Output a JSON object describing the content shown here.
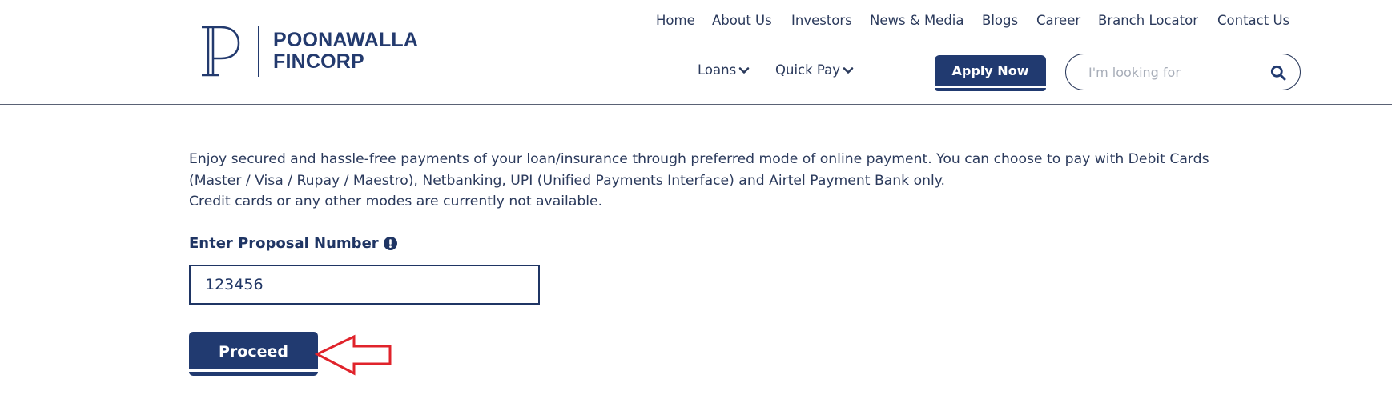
{
  "brand": {
    "name_line1": "POONAWALLA",
    "name_line2": "FINCORP",
    "logo_icon": "p-monogram-logo"
  },
  "top_nav": [
    {
      "label": "Home"
    },
    {
      "label": "About Us"
    },
    {
      "label": "Investors"
    },
    {
      "label": "News & Media"
    },
    {
      "label": "Blogs"
    },
    {
      "label": "Career"
    },
    {
      "label": "Branch Locator"
    },
    {
      "label": "Contact Us"
    }
  ],
  "dropdowns": {
    "loans": "Loans",
    "quick_pay": "Quick Pay"
  },
  "apply_button": "Apply Now",
  "search": {
    "placeholder": "I'm looking for",
    "icon": "search-icon"
  },
  "main": {
    "description_line1": "Enjoy secured and hassle-free payments of your loan/insurance through preferred mode of online payment. You can choose to pay with Debit Cards (Master / Visa / Rupay / Maestro), Netbanking, UPI (Unified Payments Interface) and Airtel Payment Bank only.",
    "description_line2": "Credit cards or any other modes are currently not available.",
    "proposal_label": "Enter Proposal Number",
    "proposal_value": "123456",
    "proceed_label": "Proceed"
  },
  "colors": {
    "brand_navy": "#213a70",
    "text": "#2b3a5c",
    "annotation_red": "#e0232b"
  }
}
